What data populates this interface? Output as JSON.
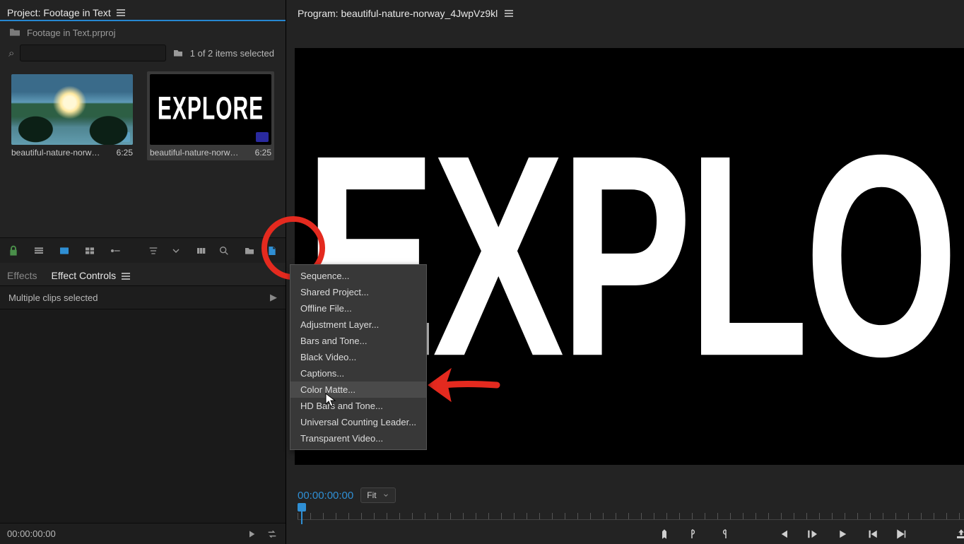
{
  "project": {
    "panel_title": "Project: Footage in Text",
    "file": "Footage in Text.prproj",
    "search_placeholder": "",
    "search_glyph": "⌕",
    "selection_text": "1 of 2 items selected",
    "clips": [
      {
        "name": "beautiful-nature-norway...",
        "duration": "6:25",
        "kind": "nature"
      },
      {
        "name": "beautiful-nature-norway...",
        "duration": "6:25",
        "kind": "explore"
      }
    ],
    "explore_thumb_text": "EXPLORE"
  },
  "new_item_menu": [
    "Sequence...",
    "Shared Project...",
    "Offline File...",
    "Adjustment Layer...",
    "Bars and Tone...",
    "Black Video...",
    "Captions...",
    "Color Matte...",
    "HD Bars and Tone...",
    "Universal Counting Leader...",
    "Transparent Video..."
  ],
  "new_item_hover_index": 7,
  "effects": {
    "tab_effects": "Effects",
    "tab_controls": "Effect Controls",
    "body_text": "Multiple clips selected",
    "footer_timecode": "00:00:00:00"
  },
  "program": {
    "panel_title": "Program: beautiful-nature-norway_4JwpVz9kl",
    "monitor_text": "EXPLOR",
    "timecode": "00:00:00:00",
    "zoom_label": "Fit"
  },
  "icons": {
    "lock": "lock-icon",
    "list": "list-view-icon",
    "icon_blue": "icon-view-icon",
    "freeform": "freeform-view-icon",
    "auto": "automate-icon",
    "sort": "sort-icon",
    "find": "find-icon",
    "newbin": "new-bin-icon",
    "newitem": "new-item-icon"
  },
  "colors": {
    "accent": "#2f8fd4",
    "annotation": "#e42a1f"
  }
}
